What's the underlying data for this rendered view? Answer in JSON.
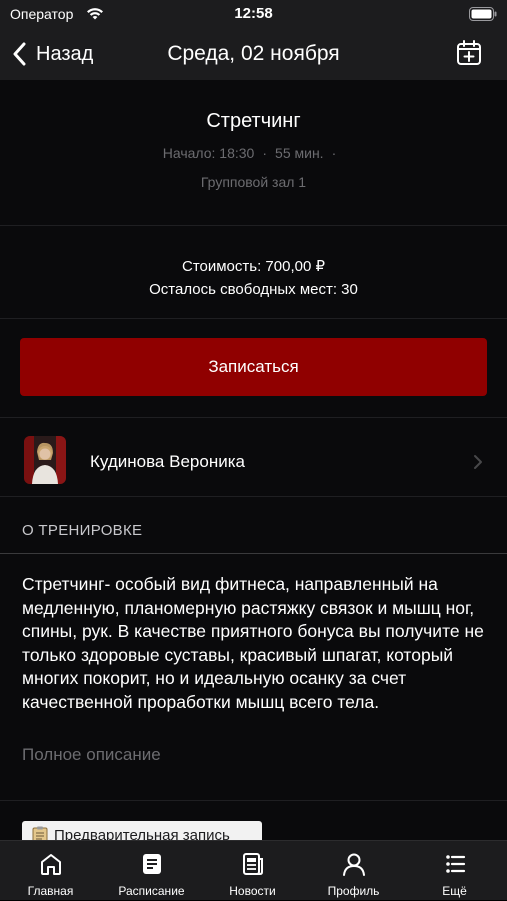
{
  "status_bar": {
    "carrier": "Оператор",
    "time": "12:58"
  },
  "nav": {
    "back_label": "Назад",
    "title": "Среда, 02 ноября"
  },
  "class_info": {
    "title": "Стретчинг",
    "start": "Начало: 18:30",
    "duration": "55 мин.",
    "room": "Групповой зал 1",
    "price": "Стоимость: 700,00 ₽",
    "seats": "Осталось свободных мест: 30"
  },
  "signup": {
    "label": "Записаться"
  },
  "trainer": {
    "name": "Кудинова Вероника"
  },
  "about": {
    "header": "О ТРЕНИРОВКЕ",
    "text": "Стретчинг- особый вид фитнеса, направленный на медленную, планомерную растяжку связок и мышц ног, спины, рук. В качестве приятного бонуса вы получите не только здоровые суставы, красивый шпагат, который многих покорит, но и идеальную осанку за счет качественной проработки мышц всего тела.",
    "full_link": "Полное описание"
  },
  "prebook": {
    "label": "Предварительная запись"
  },
  "tabs": [
    {
      "label": "Главная",
      "icon": "home-icon"
    },
    {
      "label": "Расписание",
      "icon": "schedule-icon"
    },
    {
      "label": "Новости",
      "icon": "news-icon"
    },
    {
      "label": "Профиль",
      "icon": "profile-icon"
    },
    {
      "label": "Ещё",
      "icon": "more-icon"
    }
  ],
  "colors": {
    "accent": "#900000",
    "background": "#0a0a0c",
    "bar": "#1c1c1e",
    "muted_text": "#6c6c70"
  }
}
